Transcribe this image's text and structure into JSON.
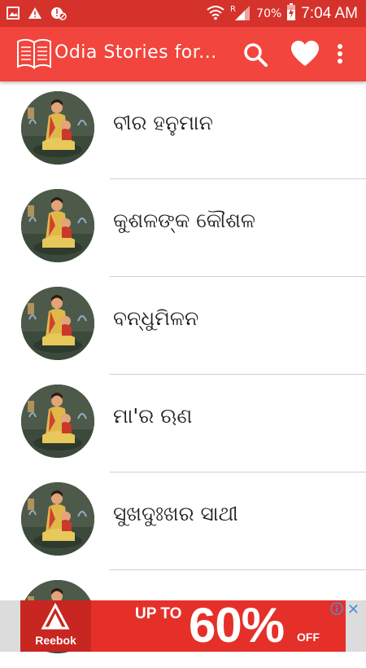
{
  "status_bar": {
    "battery_percent": "70%",
    "time": "7:04 AM",
    "icons": [
      "image-icon",
      "warning-icon",
      "blocked-icon",
      "wifi-icon",
      "roaming-signal-icon",
      "battery-charging-icon"
    ]
  },
  "app_bar": {
    "title": "Odia Stories for...",
    "icons": [
      "book-icon",
      "search-icon",
      "heart-icon",
      "more-vert-icon"
    ]
  },
  "stories": [
    {
      "title": "ବୀର ହନୁମାନ"
    },
    {
      "title": "କୁଶଳଙ୍କ କୌଶଳ"
    },
    {
      "title": "ବନ୍ଧୁମିଳନ"
    },
    {
      "title": "ମା'ର ଋଣ"
    },
    {
      "title": "ସୁଖଦୁଃଖର ସାଥୀ"
    },
    {
      "title": ""
    }
  ],
  "ad": {
    "brand": "Reebok",
    "upto": "UP TO",
    "percent": "60%",
    "off": "OFF",
    "colors": {
      "background": "#e5302a",
      "close": "#4a90d9"
    }
  },
  "colors": {
    "status_bar": "#d6322c",
    "app_bar": "#f2453d",
    "divider": "#cfcfcf",
    "text": "#222222"
  }
}
